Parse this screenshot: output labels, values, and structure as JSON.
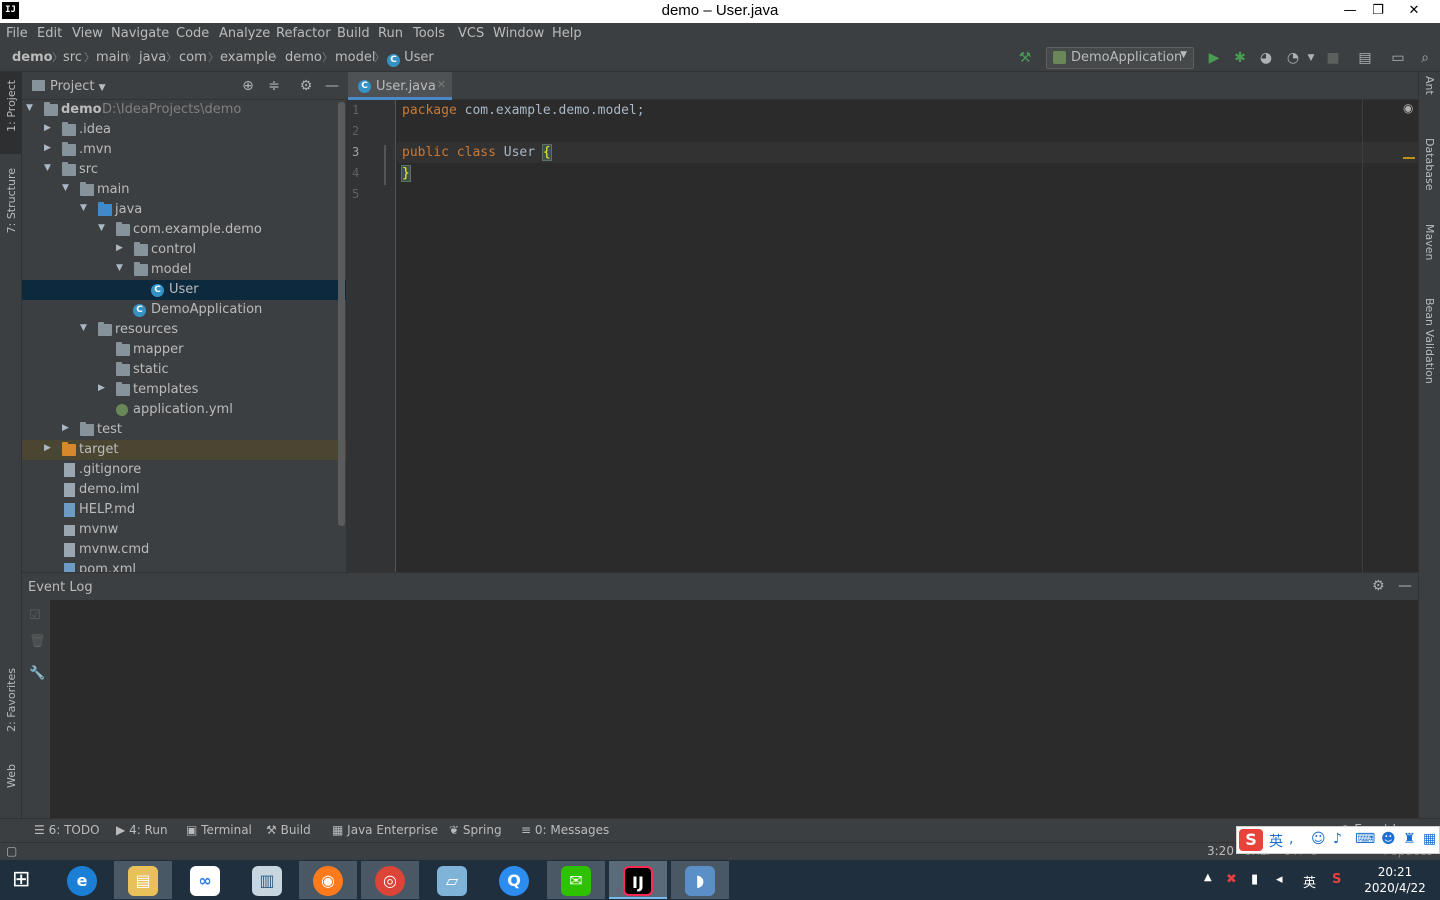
{
  "window": {
    "title": "demo – User.java",
    "app_icon_label": "IJ",
    "controls": {
      "minimize": "—",
      "restore": "❐",
      "close": "✕"
    }
  },
  "menu": [
    {
      "label": "File",
      "mnemonic_index": 0
    },
    {
      "label": "Edit"
    },
    {
      "label": "View"
    },
    {
      "label": "Navigate"
    },
    {
      "label": "Code"
    },
    {
      "label": "Analyze"
    },
    {
      "label": "Refactor"
    },
    {
      "label": "Build"
    },
    {
      "label": "Run"
    },
    {
      "label": "Tools"
    },
    {
      "label": "VCS"
    },
    {
      "label": "Window"
    },
    {
      "label": "Help"
    }
  ],
  "breadcrumbs": [
    "demo",
    "src",
    "main",
    "java",
    "com",
    "example",
    "demo",
    "model",
    "User"
  ],
  "run_config": {
    "label": "DemoApplication"
  },
  "project_panel": {
    "title": "Project",
    "tree": [
      {
        "label": "demo",
        "extra": "D:\\IdeaProjects\\demo",
        "expanded": true
      },
      {
        "label": ".idea",
        "expanded": false
      },
      {
        "label": ".mvn",
        "expanded": false
      },
      {
        "label": "src",
        "expanded": true
      },
      {
        "label": "main",
        "expanded": true
      },
      {
        "label": "java",
        "expanded": true
      },
      {
        "label": "com.example.demo",
        "expanded": true
      },
      {
        "label": "control",
        "expanded": false
      },
      {
        "label": "model",
        "expanded": true
      },
      {
        "label": "User",
        "selected": true
      },
      {
        "label": "DemoApplication"
      },
      {
        "label": "resources",
        "expanded": true
      },
      {
        "label": "mapper"
      },
      {
        "label": "static"
      },
      {
        "label": "templates",
        "expanded": false
      },
      {
        "label": "application.yml"
      },
      {
        "label": "test",
        "expanded": false
      },
      {
        "label": "target",
        "expanded": false,
        "excluded": true
      },
      {
        "label": ".gitignore"
      },
      {
        "label": "demo.iml"
      },
      {
        "label": "HELP.md"
      },
      {
        "label": "mvnw"
      },
      {
        "label": "mvnw.cmd"
      },
      {
        "label": "pom.xml"
      }
    ]
  },
  "editor": {
    "tab_label": "User.java",
    "line_numbers": [
      "1",
      "2",
      "3",
      "4",
      "5"
    ],
    "lines": {
      "l1_kw": "package",
      "l1_rest": " com.example.demo.model;",
      "l3_kw": "public class",
      "l3_name": " User ",
      "l3_brace": "{",
      "l4_brace": "}"
    }
  },
  "left_stripe": {
    "project": "1: Project",
    "structure": "7: Structure",
    "favorites": "2: Favorites",
    "web": "Web"
  },
  "right_stripe": {
    "ant": "Ant",
    "database": "Database",
    "maven": "Maven",
    "bean": "Bean Validation"
  },
  "event_log": {
    "title": "Event Log"
  },
  "tool_strip": [
    {
      "label": "6: TODO"
    },
    {
      "label": "4: Run"
    },
    {
      "label": "Terminal"
    },
    {
      "label": "Build"
    },
    {
      "label": "Java Enterprise"
    },
    {
      "label": "Spring"
    },
    {
      "label": "0: Messages"
    }
  ],
  "status": {
    "position": "3:20",
    "line_sep": "CRLF",
    "encoding": "UTF-8",
    "indent": "4 spaces",
    "event_log": "Event Log"
  },
  "ime": {
    "lang": "英"
  },
  "taskbar": {
    "tray_lang": "英",
    "time": "20:21",
    "date": "2020/4/22"
  },
  "colors": {
    "accent": "#4a88c7",
    "selection": "#0d293e",
    "keyword": "#cc7832",
    "run_green": "#499c54"
  }
}
